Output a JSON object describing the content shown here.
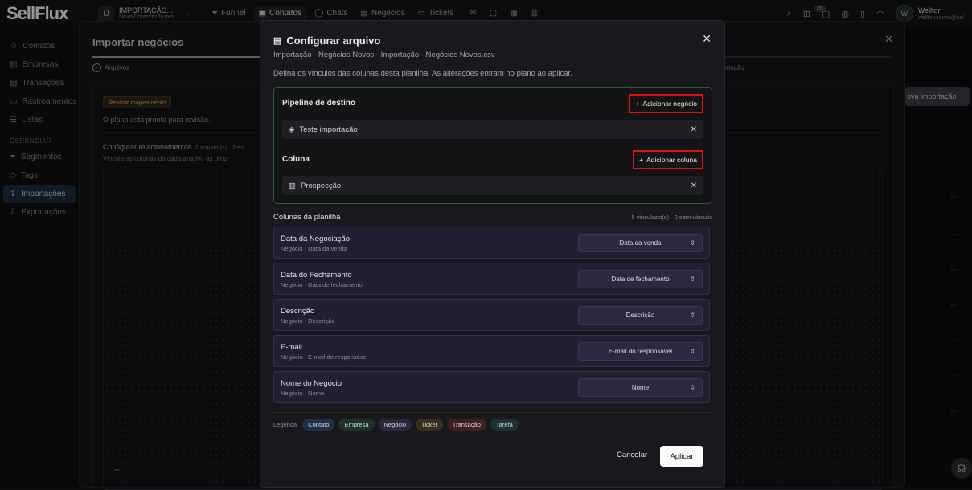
{
  "topbar": {
    "logo": "SellFlux",
    "workspace_initials": "IJ",
    "workspace_name": "IMPORTAÇÃO...",
    "workspace_sub": "Novo Contexto Testes",
    "nav": [
      "Funnel",
      "Contatos",
      "Chats",
      "Negócios",
      "Tickets"
    ],
    "notification_count": "28",
    "user_initial": "W",
    "user_name": "Wellton",
    "user_email": "wellton.rocha@sel"
  },
  "sidebar": {
    "items": [
      "Contatos",
      "Empresas",
      "Transações",
      "Rastreamentos",
      "Listas"
    ],
    "section": "GERENCIAR",
    "manage_items": [
      "Segmentos",
      "Tags",
      "Importações",
      "Exportações"
    ]
  },
  "background": {
    "title": "Importar negócios",
    "step1": "Arquivos",
    "step_last": "ortação",
    "pill": "Revisar mapeamento",
    "ready": "O plano está pronto para revisão.",
    "cfg": "Configurar relacionamentos",
    "cfg_meta": "2 arquivo(s) · 2 en",
    "cfg_sub": "Vincule as colunas de cada arquivo às propr",
    "new_import": "ova importação"
  },
  "modal": {
    "title": "Configurar arquivo",
    "breadcrumb": "Importação - Negócios Novos - Importação - Negócios Novos.csv",
    "description": "Defina os vínculos das colunas desta planilha. As alterações entram no plano ao aplicar.",
    "pipeline_label": "Pipeline de destino",
    "add_deal": "Adicionar negócio",
    "pipeline_value": "Teste importação",
    "column_label": "Coluna",
    "add_column": "Adicionar coluna",
    "column_value": "Prospecção",
    "cols_header": "Colunas da planilha",
    "cols_meta": "5 vinculado(s)  ·  0 sem vínculo",
    "rows": [
      {
        "name": "Data da Negociação",
        "sub": "Negócio · Data da venda",
        "value": "Data da venda"
      },
      {
        "name": "Data do Fechamento",
        "sub": "Negócio · Data de fechamento",
        "value": "Data de fechamento"
      },
      {
        "name": "Descrição",
        "sub": "Negócio · Descrição",
        "value": "Descrição"
      },
      {
        "name": "E-mail",
        "sub": "Negócio · E-mail do responsável",
        "value": "E-mail do responsável"
      },
      {
        "name": "Nome do Negócio",
        "sub": "Negócio · Nome",
        "value": "Nome"
      }
    ],
    "legend_label": "Legenda",
    "legend": [
      {
        "label": "Contato",
        "color": "#1f3045"
      },
      {
        "label": "Empresa",
        "color": "#1c3328"
      },
      {
        "label": "Negócio",
        "color": "#2a2740"
      },
      {
        "label": "Ticket",
        "color": "#3a2e1c"
      },
      {
        "label": "Transação",
        "color": "#3e1f22"
      },
      {
        "label": "Tarefa",
        "color": "#1b3234"
      }
    ],
    "cancel": "Cancelar",
    "apply": "Aplicar"
  }
}
